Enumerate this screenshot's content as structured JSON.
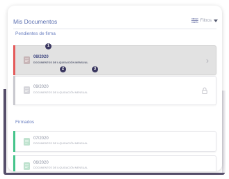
{
  "header": {
    "title": "Mis Documentos",
    "filters_label": "Filtros",
    "filters_icon": "sliders-icon",
    "dropdown_icon": "caret-down-icon"
  },
  "sections": {
    "pending": {
      "label": "Pendientes de firma",
      "cards": [
        {
          "date": "08/2020",
          "desc": "DOCUMENTOS DE LIQUIDACIÓN MENSUAL",
          "accent": "#e55b5b",
          "trailing": "chevron-right-icon",
          "selected": true
        },
        {
          "date": "09/2020",
          "desc": "DOCUMENTOS DE LIQUIDACIÓN MENSUAL",
          "accent": "#c9c9cf",
          "trailing": "lock-icon",
          "selected": false
        }
      ]
    },
    "signed": {
      "label": "Firmados",
      "cards": [
        {
          "date": "07/2020",
          "desc": "DOCUMENTOS DE LIQUIDACIÓN MENSUAL",
          "accent": "#46c48b"
        },
        {
          "date": "06/2020",
          "desc": "DOCUMENTOS DE LIQUIDACIÓN MENSUAL",
          "accent": "#46c48b"
        }
      ]
    }
  },
  "markers": [
    "1",
    "2",
    "3"
  ],
  "colors": {
    "brand_text": "#5b6fb0",
    "pending_accent": "#e55b5b",
    "signed_accent": "#46c48b",
    "marker_bg": "#3a3760",
    "frame": "#57506c"
  }
}
